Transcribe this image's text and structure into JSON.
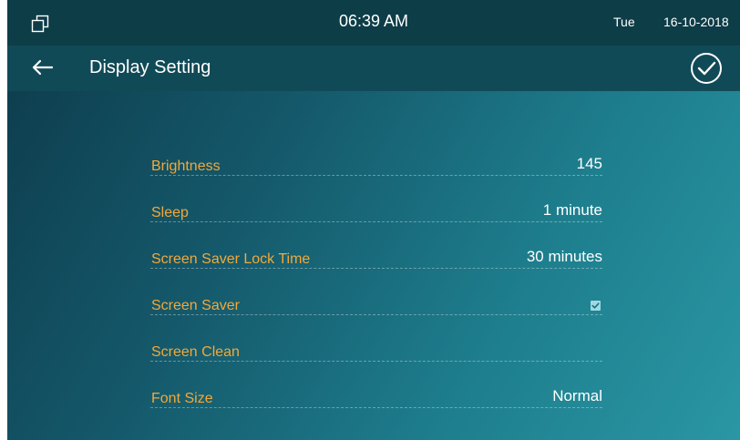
{
  "status_bar": {
    "time": "06:39 AM",
    "day": "Tue",
    "date": "16-10-2018",
    "multiwindow_icon": "multi-window-icon"
  },
  "title_bar": {
    "title": "Display Setting",
    "back_icon": "arrow-left-icon",
    "confirm_icon": "check-circle-icon"
  },
  "settings": {
    "brightness": {
      "label": "Brightness",
      "value": "145"
    },
    "sleep": {
      "label": "Sleep",
      "value": "1 minute"
    },
    "lock_time": {
      "label": "Screen Saver Lock Time",
      "value": "30 minutes"
    },
    "screen_saver": {
      "label": "Screen Saver",
      "checked": true
    },
    "screen_clean": {
      "label": "Screen Clean"
    },
    "font_size": {
      "label": "Font Size",
      "value": "Normal"
    }
  },
  "colors": {
    "label": "#f3a83a",
    "value": "#ffffff",
    "status_bar": "#0d3d47",
    "title_bar": "#114a57",
    "checkbox": "#9fd9e3"
  }
}
